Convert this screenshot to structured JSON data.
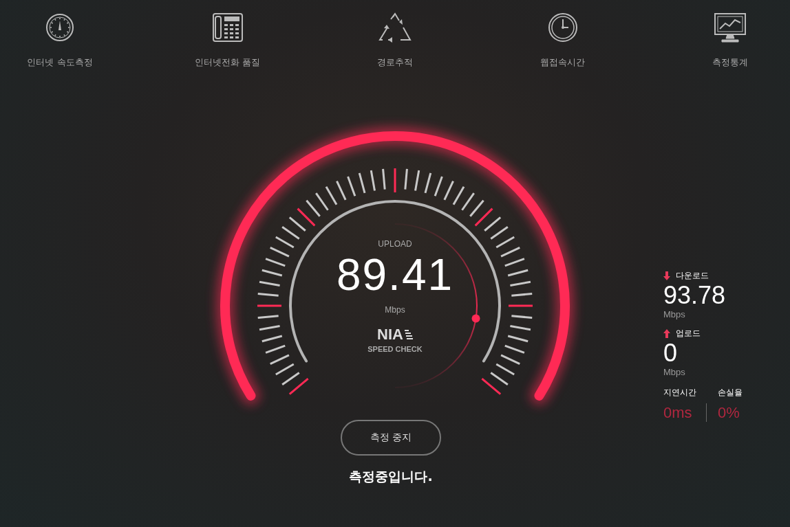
{
  "nav": [
    {
      "label": "인터넷 속도측정",
      "kind": "speed"
    },
    {
      "label": "인터넷전화 품질",
      "kind": "phone"
    },
    {
      "label": "경로추적",
      "kind": "route"
    },
    {
      "label": "웹접속시간",
      "kind": "web"
    },
    {
      "label": "측정통계",
      "kind": "stats"
    }
  ],
  "gauge": {
    "mode": "UPLOAD",
    "value": "89.41",
    "unit": "Mbps",
    "logo": "NIA",
    "logo_sub": "SPEED CHECK"
  },
  "results": [
    {
      "kind": "download",
      "label": "다운로드",
      "value": "93.78",
      "unit": "Mbps"
    },
    {
      "kind": "upload",
      "label": "업로드",
      "value": "0",
      "unit": "Mbps"
    }
  ],
  "metrics": [
    {
      "label": "지연시간",
      "value": "0ms"
    },
    {
      "label": "손실율",
      "value": "0%"
    }
  ],
  "stop_button": "측정 중지",
  "status": "측정중입니다."
}
